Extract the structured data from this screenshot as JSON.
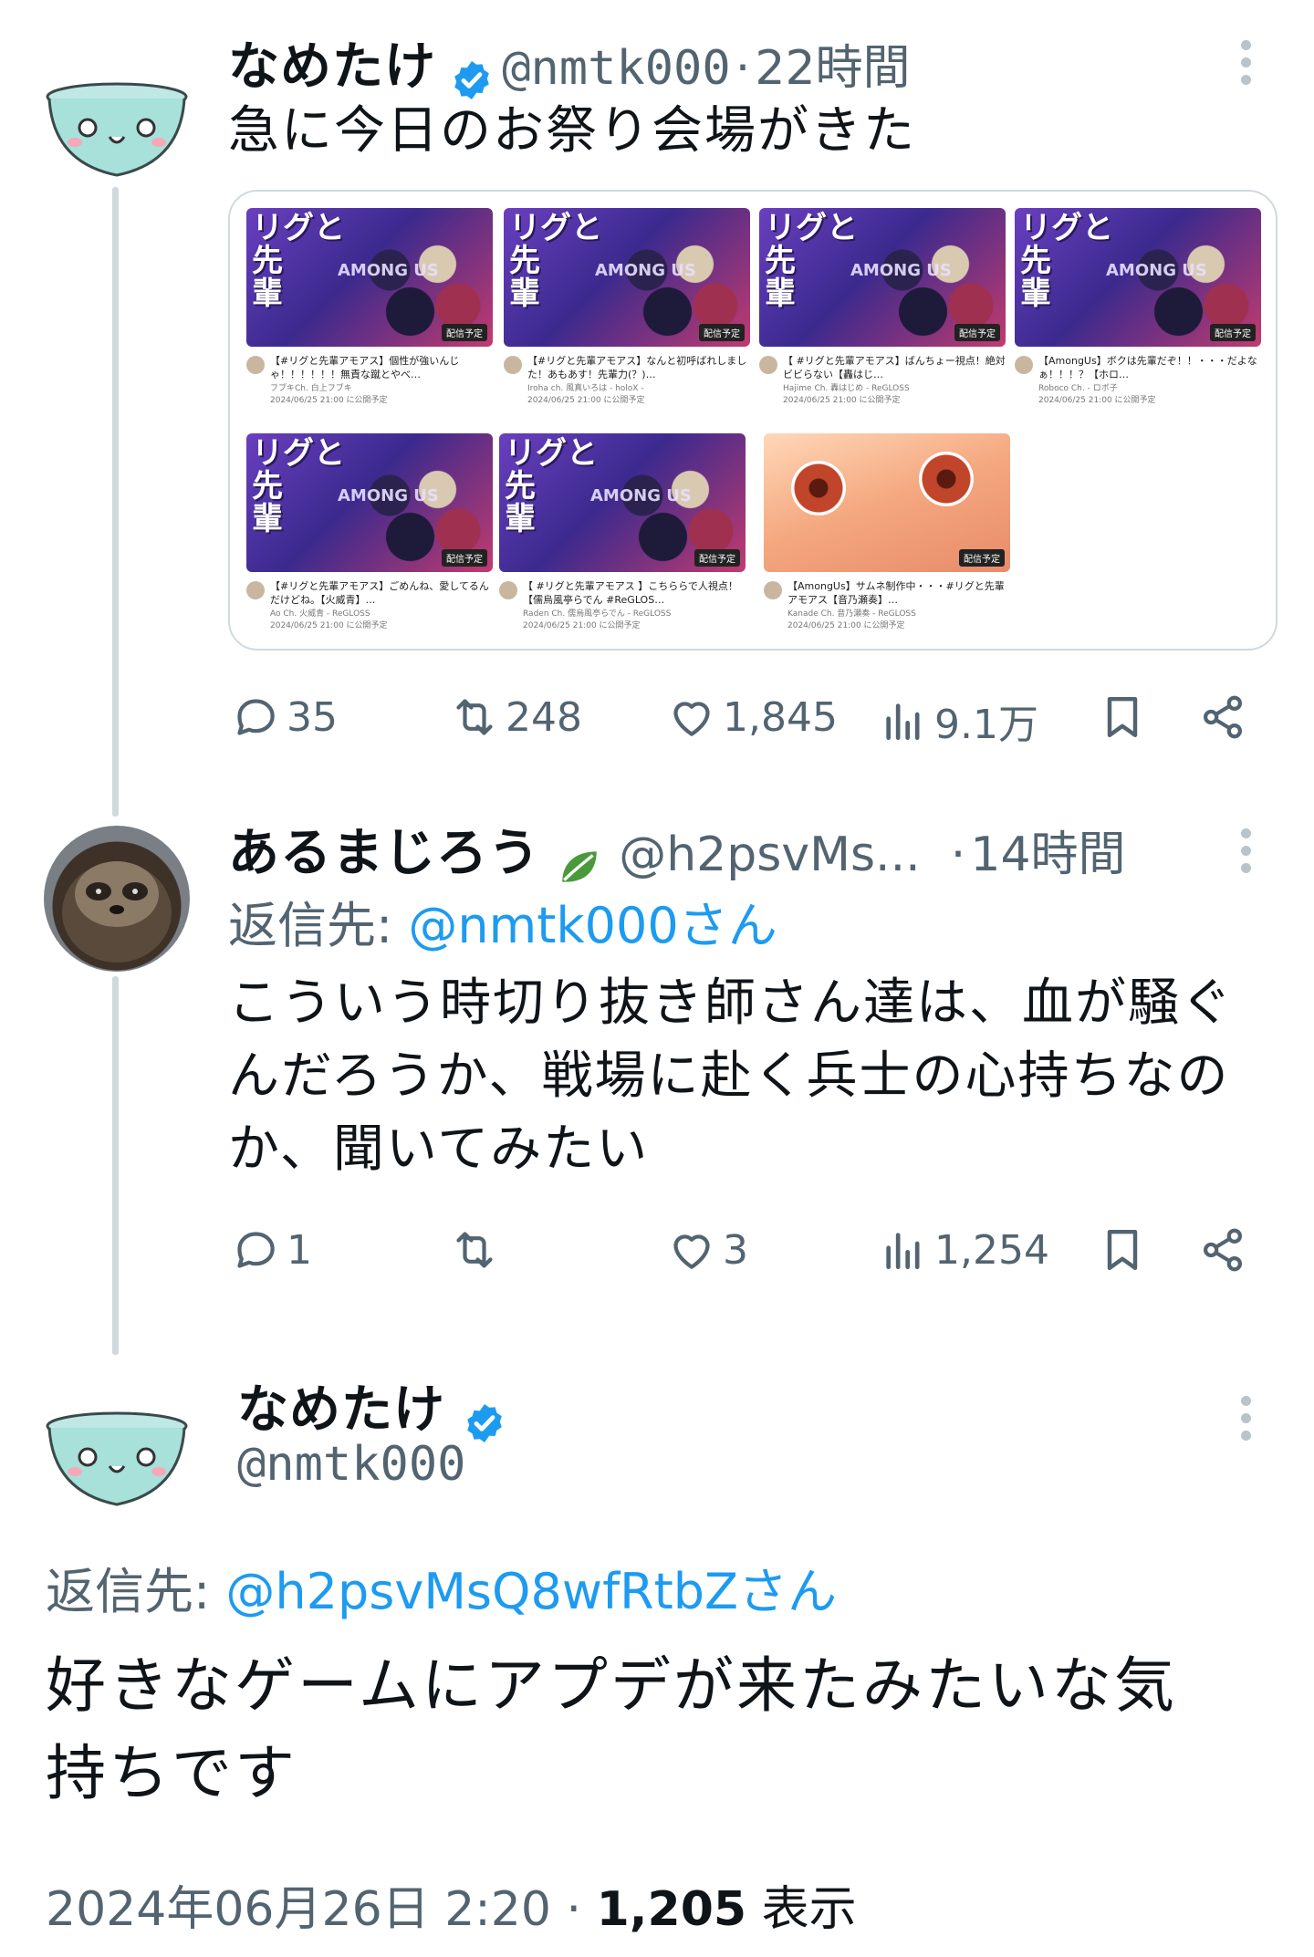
{
  "tweets": [
    {
      "name": "なめたけ",
      "handle": "@nmtk000",
      "dot": "·",
      "time": "22時間",
      "text": "急に今日のお祭り会場がきた",
      "stats": {
        "replies": "35",
        "retweets": "248",
        "likes": "1,845",
        "views": "9.1万"
      },
      "videos": [
        {
          "thumb_title": "リグと\n先\n輩",
          "thumb_sub": "AMONG US",
          "badge": "配信予定",
          "title": "【#リグと先輩アモアス】個性が強いんじゃ！！！！！！無責な蹴とやべ…",
          "channel": "フブキCh. 白上フブキ",
          "date": "2024/06/25 21:00 に公開予定"
        },
        {
          "thumb_title": "リグと\n先\n輩",
          "thumb_sub": "AMONG US",
          "badge": "配信予定",
          "title": "【#リグと先輩アモアス】なんと初呼ばれしました！あもあす！先輩力(？)…",
          "channel": "Iroha ch. 風真いろは - holoX -",
          "date": "2024/06/25 21:00 に公開予定"
        },
        {
          "thumb_title": "リグと\n先\n輩",
          "thumb_sub": "AMONG US",
          "badge": "配信予定",
          "title": "【 #リグと先輩アモアス】ばんちょー視点！絶対ビビらない【轟はじ…",
          "channel": "Hajime Ch. 轟はじめ - ReGLOSS",
          "date": "2024/06/25 21:00 に公開予定"
        },
        {
          "thumb_title": "リグと\n先\n輩",
          "thumb_sub": "AMONG US",
          "badge": "配信予定",
          "title": "【AmongUs】ボクは先輩だぞ！！・・・だよなぁ！！！？【ホロ…",
          "channel": "Roboco Ch. - ロボ子",
          "date": "2024/06/25 21:00 に公開予定"
        },
        {
          "thumb_title": "リグと\n先\n輩",
          "thumb_sub": "AMONG US",
          "badge": "配信予定",
          "title": "【#リグと先輩アモアス】ごめんね、愛してるんだけどね。【火威青】…",
          "channel": "Ao Ch. 火威青 - ReGLOSS",
          "date": "2024/06/25 21:00 に公開予定"
        },
        {
          "thumb_title": "リグと\n先\n輩",
          "thumb_sub": "AMONG US",
          "badge": "配信予定",
          "title": "【 #リグと先輩アモアス 】こちららで人視点！【儒烏風亭らでん #ReGLOS…",
          "channel": "Raden Ch. 儒烏風亭らでん - ReGLOSS",
          "date": "2024/06/25 21:00 に公開予定"
        },
        {
          "thumb_title": "",
          "thumb_sub": "",
          "badge": "配信予定",
          "title": "【AmongUs】サムネ制作中・・・#リグと先輩アモアス【音乃瀬奏】…",
          "channel": "Kanade Ch. 音乃瀬奏 - ReGLOSS",
          "date": "2024/06/25 21:00 に公開予定"
        }
      ]
    },
    {
      "name": "あるまじろう",
      "handle": "@h2psvMs...",
      "dot": "·",
      "time": "14時間",
      "reply_label": "返信先:",
      "reply_target": "@nmtk000さん",
      "text_lines": [
        "こういう時切り抜き師さん達は、血が騒ぐ",
        "んだろうか、戦場に赴く兵士の心持ちなの",
        "か、聞いてみたい"
      ],
      "stats": {
        "replies": "1",
        "retweets": "",
        "likes": "3",
        "views": "1,254"
      }
    },
    {
      "name": "なめたけ",
      "handle": "@nmtk000",
      "reply_label": "返信先:",
      "reply_target": "@h2psvMsQ8wfRtbZさん",
      "text_lines": [
        "好きなゲームにアプデが来たみたいな気",
        "持ちです"
      ],
      "footer": {
        "datetime": "2024年06月26日 2:20",
        "dot": "·",
        "views": "1,205",
        "views_label": "表示"
      }
    }
  ],
  "colors": {
    "accent": "#1d9bf0",
    "muted": "#536471",
    "text": "#0f1419",
    "verified": "#1d9bf0"
  },
  "icons": [
    "reply-icon",
    "retweet-icon",
    "like-icon",
    "views-icon",
    "bookmark-icon",
    "share-icon",
    "verified-icon",
    "more-icon",
    "leaf-icon"
  ]
}
